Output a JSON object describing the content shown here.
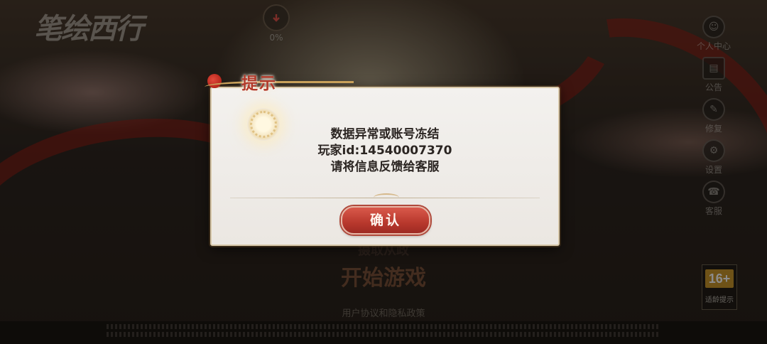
{
  "background": {
    "logo_text": "笔绘西行",
    "download": {
      "percent": "0%"
    },
    "sidebar": [
      {
        "label": "个人中心",
        "icon": "user-icon"
      },
      {
        "label": "公告",
        "icon": "notice-icon"
      },
      {
        "label": "修复",
        "icon": "repair-icon"
      },
      {
        "label": "设置",
        "icon": "gear-icon"
      },
      {
        "label": "客服",
        "icon": "support-icon"
      }
    ],
    "server_label": "摄取从政",
    "start_button": "开始游戏",
    "agreement_text": "用户协议和隐私政策",
    "age_badge": {
      "rating": "16+",
      "caption": "适龄提示"
    }
  },
  "dialog": {
    "title": "提示",
    "lines": [
      "数据异常或账号冻结",
      "玩家id:14540007370",
      "请将信息反馈给客服"
    ],
    "confirm_label": "确认"
  },
  "colors": {
    "accent_red": "#b8382d",
    "title_red": "#b23a2a",
    "dialog_bg": "#f3f1ee",
    "gold": "#c9962a"
  }
}
